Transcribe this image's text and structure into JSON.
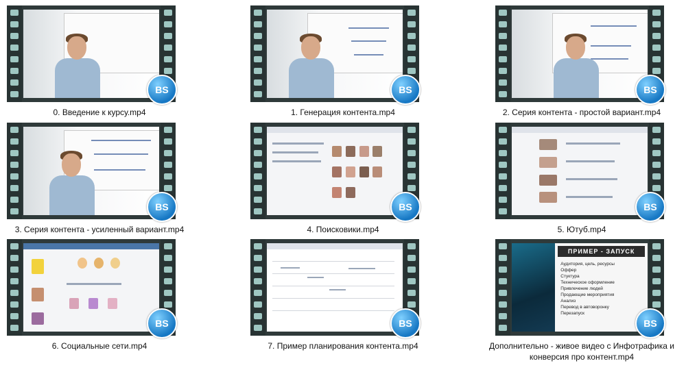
{
  "files": [
    {
      "caption": "0. Введение к курсу.mp4",
      "badge": "BS",
      "scene": "whiteboard"
    },
    {
      "caption": "1. Генерация контента.mp4",
      "badge": "BS",
      "scene": "whiteboard"
    },
    {
      "caption": "2. Серия контента - простой вариант.mp4",
      "badge": "BS",
      "scene": "whiteboard"
    },
    {
      "caption": "3. Серия контента - усиленный вариант.mp4",
      "badge": "BS",
      "scene": "whiteboard"
    },
    {
      "caption": "4. Поисковики.mp4",
      "badge": "BS",
      "scene": "web-images"
    },
    {
      "caption": "5. Ютуб.mp4",
      "badge": "BS",
      "scene": "web-video"
    },
    {
      "caption": "6. Социальные сети.mp4",
      "badge": "BS",
      "scene": "web-social"
    },
    {
      "caption": "7. Пример планирования контента.mp4",
      "badge": "BS",
      "scene": "spreadsheet"
    },
    {
      "caption": "Дополнительно - живое видео с Инфотрафика и конверсия про контент.mp4",
      "badge": "BS",
      "scene": "slide"
    }
  ],
  "slide": {
    "title": "ПРИМЕР - ЗАПУСК",
    "bullets": [
      "Аудитория, цель, ресурсы",
      "Оффер",
      "Стуктура",
      "Техническое оформление",
      "Привлечение людей",
      "Продающие мероприятия",
      "Анализ",
      "Перевод в автоворонку",
      "Перезапуск"
    ]
  },
  "colors": {
    "film": "#283333",
    "film_hole": "#9fc7c2",
    "badge": "#1778c4"
  }
}
